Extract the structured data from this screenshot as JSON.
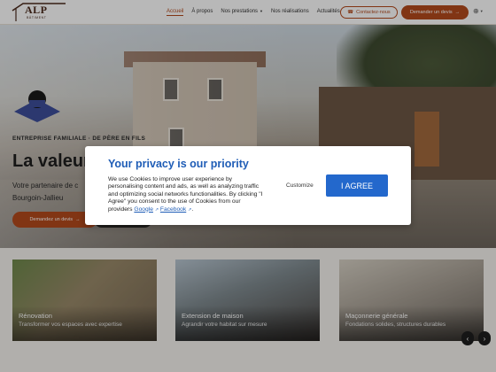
{
  "header": {
    "logo_text": "ALP",
    "logo_sub": "BÂTIMENT",
    "nav": [
      {
        "label": "Accueil",
        "active": true,
        "dropdown": false
      },
      {
        "label": "À propos",
        "active": false,
        "dropdown": false
      },
      {
        "label": "Nos prestations",
        "active": false,
        "dropdown": true
      },
      {
        "label": "Nos réalisations",
        "active": false,
        "dropdown": false
      },
      {
        "label": "Actualités",
        "active": false,
        "dropdown": false
      }
    ],
    "contact_label": "Contactez-nous",
    "devis_label": "Demander un devis",
    "lang_icon": "globe-icon"
  },
  "hero": {
    "tagline": "ENTREPRISE FAMILIALE · DE PÈRE EN FILS",
    "headline": "La valeur",
    "sub_line1": "Votre partenaire de c",
    "sub_line2": "Bourgoin-Jallieu",
    "cta_label": "Demandez un devis"
  },
  "cards": [
    {
      "title": "Rénovation",
      "desc": "Transformer vos espaces avec expertise",
      "bg": "#8a7a60"
    },
    {
      "title": "Extension de maison",
      "desc": "Agrandir votre habitat sur mesure",
      "bg": "#6f7a82"
    },
    {
      "title": "Maçonnerie générale",
      "desc": "Fondations solides, structures durables",
      "bg": "#9a8f80"
    }
  ],
  "modal": {
    "title": "Your privacy is our priority",
    "body": "We use Cookies to improve user experience by personalising content and ads, as well as analyzing traffic and optimizing social networks functionalities. By clicking \"I Agree\" you consent to the use of Cookies from our providers",
    "link_google": "Google",
    "link_facebook": "Facebook",
    "customize_label": "Customize",
    "agree_label": "I AGREE"
  },
  "colors": {
    "accent": "#b34a1d",
    "modal_blue": "#2368cc"
  }
}
